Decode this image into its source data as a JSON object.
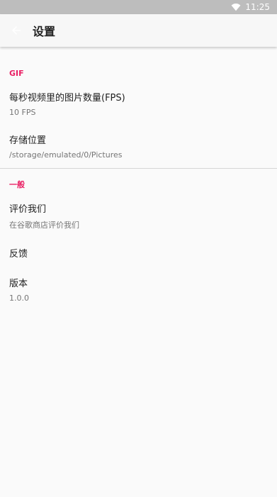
{
  "status_bar": {
    "time": "11:25"
  },
  "toolbar": {
    "title": "设置"
  },
  "sections": [
    {
      "header": "GIF",
      "items": [
        {
          "title": "每秒视频里的图片数量(FPS)",
          "summary": "10 FPS"
        },
        {
          "title": "存储位置",
          "summary": "/storage/emulated/0/Pictures"
        }
      ]
    },
    {
      "header": "一般",
      "items": [
        {
          "title": "评价我们",
          "summary": "在谷歌商店评价我们"
        },
        {
          "title": "反馈"
        },
        {
          "title": "版本",
          "summary": "1.0.0"
        }
      ]
    }
  ],
  "colors": {
    "accent": "#e91e63",
    "toolbar": "#f7f7f7",
    "status_bar": "#bdbdbd",
    "background": "#fafafa"
  }
}
